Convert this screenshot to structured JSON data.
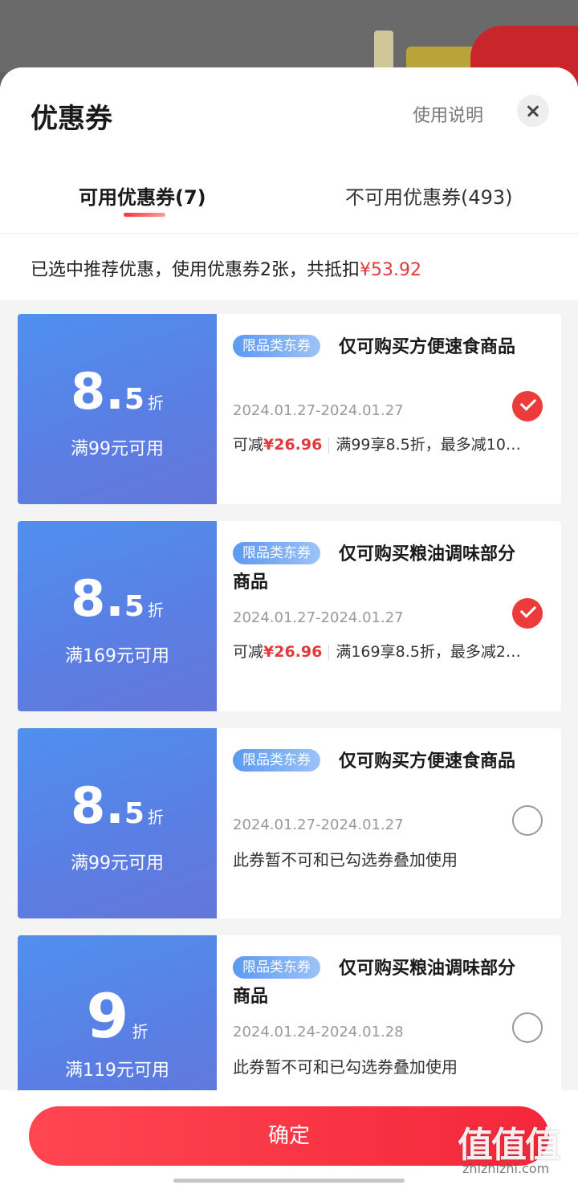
{
  "sheet": {
    "title": "优惠券",
    "help_link": "使用说明",
    "close_icon": "close-icon"
  },
  "tabs": [
    {
      "label": "可用优惠券(7)",
      "active": true
    },
    {
      "label": "不可用优惠券(493)",
      "active": false
    }
  ],
  "summary": {
    "text": "已选中推荐优惠，使用优惠券2张，共抵扣",
    "amount": "¥53.92"
  },
  "coupons": [
    {
      "discount_main": "8.",
      "discount_dec": "5",
      "discount_unit": "折",
      "condition": "满99元可用",
      "tag": "限品类东券",
      "title": "仅可购买方便速食商品",
      "date": "2024.01.27-2024.01.27",
      "saving_label": "可减",
      "saving_amount": "¥26.96",
      "rule": "满99享8.5折，最多减10…",
      "checked": true
    },
    {
      "discount_main": "8.",
      "discount_dec": "5",
      "discount_unit": "折",
      "condition": "满169元可用",
      "tag": "限品类东券",
      "title": "仅可购买粮油调味部分商品",
      "date": "2024.01.27-2024.01.27",
      "saving_label": "可减",
      "saving_amount": "¥26.96",
      "rule": "满169享8.5折，最多减2…",
      "checked": true
    },
    {
      "discount_main": "8.",
      "discount_dec": "5",
      "discount_unit": "折",
      "condition": "满99元可用",
      "tag": "限品类东券",
      "title": "仅可购买方便速食商品",
      "date": "2024.01.27-2024.01.27",
      "note": "此券暂不可和已勾选券叠加使用",
      "checked": false
    },
    {
      "discount_main": "9",
      "discount_dec": "",
      "discount_unit": "折",
      "condition": "满119元可用",
      "tag": "限品类东券",
      "title": "仅可购买粮油调味部分商品",
      "date": "2024.01.24-2024.01.28",
      "note": "此券暂不可和已勾选券叠加使用",
      "checked": false
    }
  ],
  "footer": {
    "confirm_label": "确定"
  },
  "watermark": {
    "logo": "值值值",
    "text": "zhizhizhi.com"
  },
  "colors": {
    "accent_red": "#e4393c",
    "coupon_blue": "#5a7fe4"
  }
}
